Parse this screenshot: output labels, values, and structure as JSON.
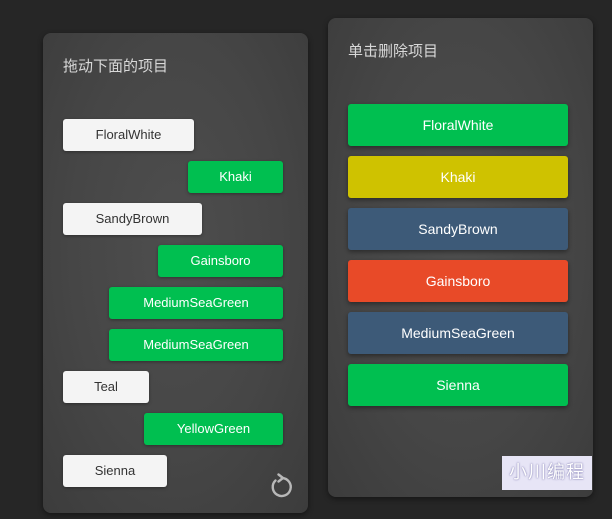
{
  "left_panel": {
    "title": "拖动下面的项目",
    "items": [
      {
        "label": "FloralWhite",
        "style": "white"
      },
      {
        "label": "Khaki",
        "style": "green"
      },
      {
        "label": "SandyBrown",
        "style": "white"
      },
      {
        "label": "Gainsboro",
        "style": "green"
      },
      {
        "label": "MediumSeaGreen",
        "style": "green"
      },
      {
        "label": "MediumSeaGreen",
        "style": "green"
      },
      {
        "label": "Teal",
        "style": "white"
      },
      {
        "label": "YellowGreen",
        "style": "green"
      },
      {
        "label": "Sienna",
        "style": "white"
      }
    ],
    "refresh_icon": "refresh-icon"
  },
  "right_panel": {
    "title": "单击删除项目",
    "items": [
      {
        "label": "FloralWhite",
        "color": "#00bf50"
      },
      {
        "label": "Khaki",
        "color": "#cfc200"
      },
      {
        "label": "SandyBrown",
        "color": "#3d5a78"
      },
      {
        "label": "Gainsboro",
        "color": "#e84a28"
      },
      {
        "label": "MediumSeaGreen",
        "color": "#3d5a78"
      },
      {
        "label": "Sienna",
        "color": "#00bf50"
      }
    ]
  },
  "watermark": "小川编程",
  "colors": {
    "green": "#00bf50",
    "white": "#f4f4f4",
    "background": "#262626"
  }
}
